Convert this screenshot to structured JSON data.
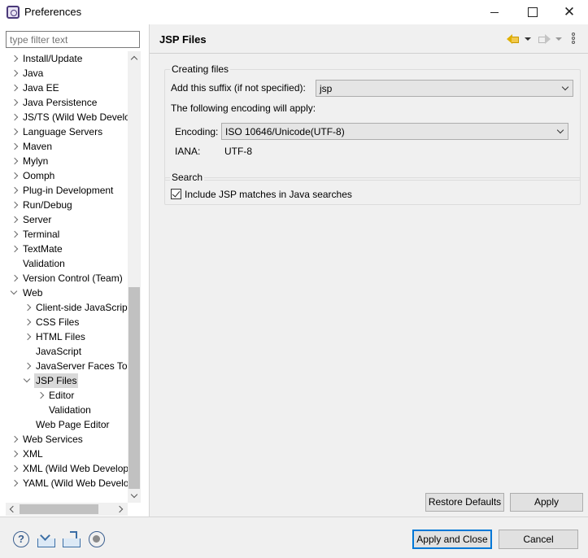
{
  "window": {
    "title": "Preferences"
  },
  "filter": {
    "placeholder": "type filter text"
  },
  "tree": [
    {
      "label": "Install/Update",
      "level": 0,
      "expander": "collapsed"
    },
    {
      "label": "Java",
      "level": 0,
      "expander": "collapsed"
    },
    {
      "label": "Java EE",
      "level": 0,
      "expander": "collapsed"
    },
    {
      "label": "Java Persistence",
      "level": 0,
      "expander": "collapsed"
    },
    {
      "label": "JS/TS (Wild Web Develo",
      "level": 0,
      "expander": "collapsed"
    },
    {
      "label": "Language Servers",
      "level": 0,
      "expander": "collapsed"
    },
    {
      "label": "Maven",
      "level": 0,
      "expander": "collapsed"
    },
    {
      "label": "Mylyn",
      "level": 0,
      "expander": "collapsed"
    },
    {
      "label": "Oomph",
      "level": 0,
      "expander": "collapsed"
    },
    {
      "label": "Plug-in Development",
      "level": 0,
      "expander": "collapsed"
    },
    {
      "label": "Run/Debug",
      "level": 0,
      "expander": "collapsed"
    },
    {
      "label": "Server",
      "level": 0,
      "expander": "collapsed"
    },
    {
      "label": "Terminal",
      "level": 0,
      "expander": "collapsed"
    },
    {
      "label": "TextMate",
      "level": 0,
      "expander": "collapsed"
    },
    {
      "label": "Validation",
      "level": 0,
      "expander": "none"
    },
    {
      "label": "Version Control (Team)",
      "level": 0,
      "expander": "collapsed"
    },
    {
      "label": "Web",
      "level": 0,
      "expander": "expanded"
    },
    {
      "label": "Client-side JavaScript",
      "level": 1,
      "expander": "collapsed"
    },
    {
      "label": "CSS Files",
      "level": 1,
      "expander": "collapsed"
    },
    {
      "label": "HTML Files",
      "level": 1,
      "expander": "collapsed"
    },
    {
      "label": "JavaScript",
      "level": 1,
      "expander": "none"
    },
    {
      "label": "JavaServer Faces Tools",
      "level": 1,
      "expander": "collapsed"
    },
    {
      "label": "JSP Files",
      "level": 1,
      "expander": "expanded",
      "selected": true
    },
    {
      "label": "Editor",
      "level": 2,
      "expander": "collapsed"
    },
    {
      "label": "Validation",
      "level": 2,
      "expander": "none"
    },
    {
      "label": "Web Page Editor",
      "level": 1,
      "expander": "none"
    },
    {
      "label": "Web Services",
      "level": 0,
      "expander": "collapsed"
    },
    {
      "label": "XML",
      "level": 0,
      "expander": "collapsed"
    },
    {
      "label": "XML (Wild Web Develop",
      "level": 0,
      "expander": "collapsed"
    },
    {
      "label": "YAML (Wild Web Develo",
      "level": 0,
      "expander": "collapsed"
    }
  ],
  "page": {
    "title": "JSP Files",
    "creating": {
      "group_title": "Creating files",
      "suffix_label": "Add this suffix (if not specified):",
      "suffix_value": "jsp",
      "encoding_note": "The following encoding will apply:",
      "encoding_label": "Encoding:",
      "encoding_value": "ISO 10646/Unicode(UTF-8)",
      "iana_label": "IANA:",
      "iana_value": "UTF-8"
    },
    "search": {
      "group_title": "Search",
      "checkbox_label": "Include JSP matches in Java searches",
      "checked": true
    },
    "restore_label": "Restore Defaults",
    "apply_label": "Apply"
  },
  "footer": {
    "apply_close_label": "Apply and Close",
    "cancel_label": "Cancel"
  }
}
